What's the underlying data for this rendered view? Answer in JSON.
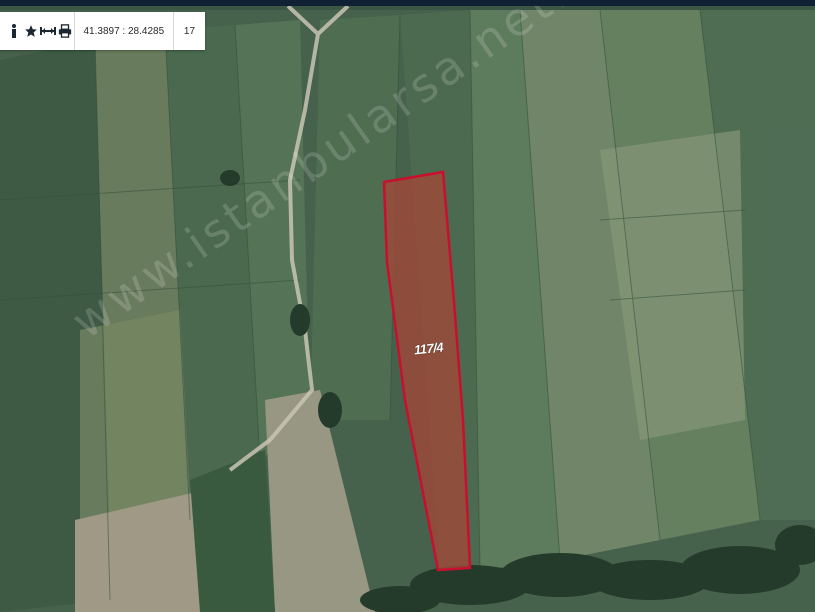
{
  "toolbar": {
    "info_icon": "info-icon",
    "star_icon": "star-icon",
    "measure_icon": "measure-icon",
    "print_icon": "print-icon",
    "coordinates": "41.3897 : 28.4285",
    "zoom_level": "17"
  },
  "map": {
    "parcel_label": "117/4",
    "watermark": "www.istanbularsa.net.tr",
    "parcel_outline_color": "#c8102e",
    "parcel_fill_color": "#9b4a3a"
  }
}
